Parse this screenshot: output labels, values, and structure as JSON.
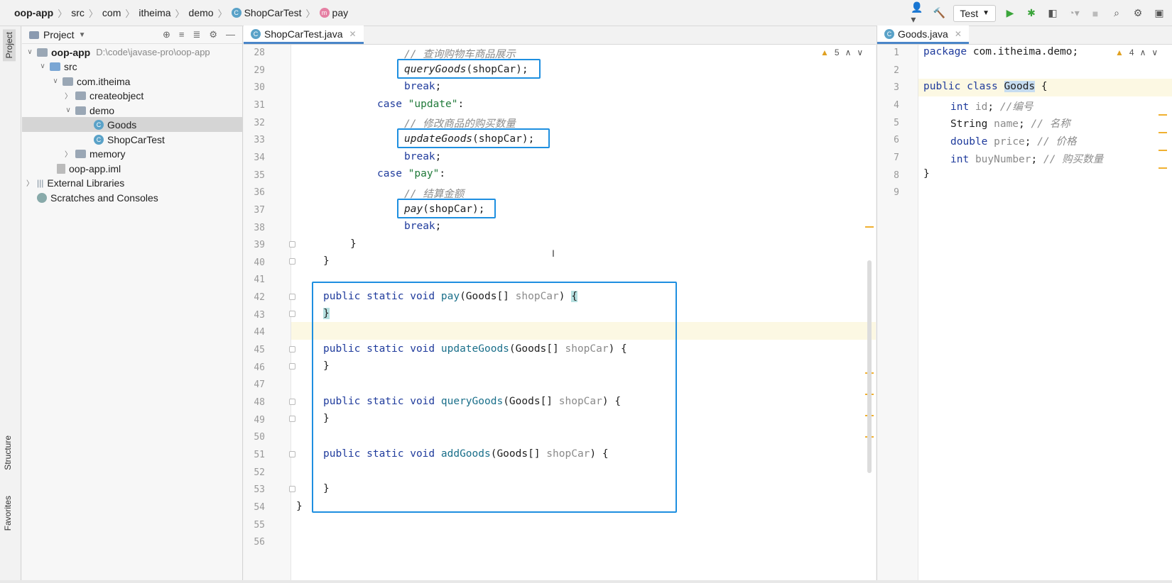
{
  "breadcrumb": {
    "items": [
      "oop-app",
      "src",
      "com",
      "itheima",
      "demo",
      "ShopCarTest",
      "pay"
    ]
  },
  "toolbar": {
    "run_config": "Test"
  },
  "left_strip": {
    "project_tab": "Project",
    "structure_tab": "Structure",
    "favorites_tab": "Favorites"
  },
  "project_panel": {
    "title": "Project",
    "tree": [
      {
        "label": "oop-app",
        "path": "D:\\code\\javase-pro\\oop-app"
      },
      {
        "label": "src"
      },
      {
        "label": "com.itheima"
      },
      {
        "label": "createobject"
      },
      {
        "label": "demo"
      },
      {
        "label": "Goods"
      },
      {
        "label": "ShopCarTest"
      },
      {
        "label": "memory"
      },
      {
        "label": "oop-app.iml"
      },
      {
        "label": "External Libraries"
      },
      {
        "label": "Scratches and Consoles"
      }
    ]
  },
  "editor_main": {
    "tab": "ShopCarTest.java",
    "warning_count": "5",
    "line_numbers": [
      "28",
      "29",
      "30",
      "31",
      "32",
      "33",
      "34",
      "35",
      "36",
      "37",
      "38",
      "39",
      "40",
      "41",
      "42",
      "43",
      "44",
      "45",
      "46",
      "47",
      "48",
      "49",
      "50",
      "51",
      "52",
      "53",
      "54",
      "55",
      "56"
    ]
  },
  "editor_side": {
    "tab": "Goods.java",
    "warning_count": "4",
    "line_numbers": [
      "1",
      "2",
      "3",
      "4",
      "5",
      "6",
      "7",
      "8",
      "9"
    ]
  },
  "colors": {
    "highlight_box": "#1e8fe0",
    "keyword": "#1f3b9c",
    "warning": "#e0a020"
  }
}
